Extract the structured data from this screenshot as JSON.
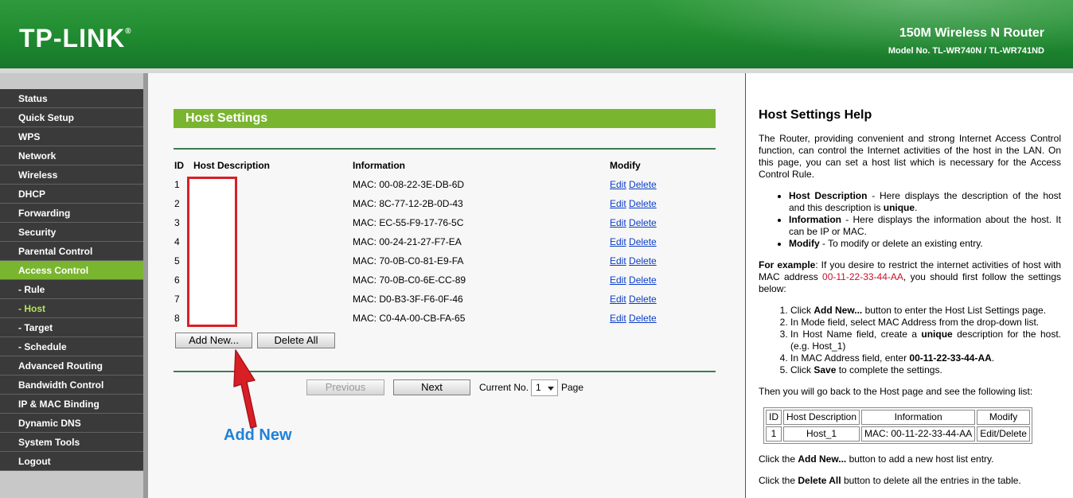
{
  "header": {
    "logo": "TP-LINK",
    "logo_mark": "®",
    "router_name": "150M Wireless N Router",
    "model_no": "Model No. TL-WR740N / TL-WR741ND"
  },
  "sidebar": {
    "items": [
      {
        "label": "Status"
      },
      {
        "label": "Quick Setup"
      },
      {
        "label": "WPS"
      },
      {
        "label": "Network"
      },
      {
        "label": "Wireless"
      },
      {
        "label": "DHCP"
      },
      {
        "label": "Forwarding"
      },
      {
        "label": "Security"
      },
      {
        "label": "Parental Control"
      },
      {
        "label": "Access Control",
        "state": "active"
      },
      {
        "label": "- Rule"
      },
      {
        "label": "- Host",
        "state": "current"
      },
      {
        "label": "- Target"
      },
      {
        "label": "- Schedule"
      },
      {
        "label": "Advanced Routing"
      },
      {
        "label": "Bandwidth Control"
      },
      {
        "label": "IP & MAC Binding"
      },
      {
        "label": "Dynamic DNS"
      },
      {
        "label": "System Tools"
      },
      {
        "label": "Logout"
      }
    ]
  },
  "main": {
    "title": "Host Settings",
    "columns": {
      "id": "ID",
      "desc": "Host Description",
      "info": "Information",
      "modify": "Modify"
    },
    "rows": [
      {
        "id": "1",
        "desc": "",
        "info": "MAC: 00-08-22-3E-DB-6D"
      },
      {
        "id": "2",
        "desc": "",
        "info": "MAC: 8C-77-12-2B-0D-43"
      },
      {
        "id": "3",
        "desc": "",
        "info": "MAC: EC-55-F9-17-76-5C"
      },
      {
        "id": "4",
        "desc": "",
        "info": "MAC: 00-24-21-27-F7-EA"
      },
      {
        "id": "5",
        "desc": "",
        "info": "MAC: 70-0B-C0-81-E9-FA"
      },
      {
        "id": "6",
        "desc": "",
        "info": "MAC: 70-0B-C0-6E-CC-89"
      },
      {
        "id": "7",
        "desc": "",
        "info": "MAC: D0-B3-3F-F6-0F-46"
      },
      {
        "id": "8",
        "desc": "",
        "info": "MAC: C0-4A-00-CB-FA-65"
      }
    ],
    "edit_label": "Edit",
    "delete_label": "Delete",
    "add_new_label": "Add New...",
    "delete_all_label": "Delete All",
    "previous_label": "Previous",
    "next_label": "Next",
    "current_no_label": "Current No.",
    "page_value": "1",
    "page_label": "Page",
    "annotation_label": "Add New"
  },
  "help": {
    "title": "Host Settings Help",
    "intro": "The Router, providing convenient and strong Internet Access Control function, can control the Internet activities of the host in the LAN. On this page, you can set a host list which is necessary for the Access Control Rule.",
    "bullets": [
      {
        "term": "Host Description",
        "text_a": " - Here displays the description of the host and this description is ",
        "strong": "unique",
        "text_b": "."
      },
      {
        "term": "Information",
        "text_a": " - Here displays the information about the host. It can be IP or MAC.",
        "strong": "",
        "text_b": ""
      },
      {
        "term": "Modify",
        "text_a": " - To modify or delete an existing entry.",
        "strong": "",
        "text_b": ""
      }
    ],
    "example_lead": "For example",
    "example_a": ": If you desire to restrict the internet activities of host with MAC address ",
    "example_mac": "00-11-22-33-44-AA",
    "example_b": ", you should first follow the settings below:",
    "steps": [
      {
        "a": "Click ",
        "strong": "Add New...",
        "b": " button to enter the Host List Settings page."
      },
      {
        "a": "In Mode field, select MAC Address from the drop-down list.",
        "strong": "",
        "b": ""
      },
      {
        "a": "In Host Name field, create a ",
        "strong": "unique",
        "b": " description for the host. (e.g. Host_1)"
      },
      {
        "a": "In MAC Address field, enter ",
        "strong": "00-11-22-33-44-AA",
        "b": "."
      },
      {
        "a": "Click ",
        "strong": "Save",
        "b": " to complete the settings."
      }
    ],
    "then_text": "Then you will go back to the Host page and see the following list:",
    "example_table": {
      "headers": [
        "ID",
        "Host Description",
        "Information",
        "Modify"
      ],
      "row": [
        "1",
        "Host_1",
        "MAC: 00-11-22-33-44-AA",
        "Edit/Delete"
      ]
    },
    "click_add_a": "Click the ",
    "click_add_strong": "Add New...",
    "click_add_b": " button to add a new host list entry.",
    "click_delete_a": "Click the ",
    "click_delete_strong": "Delete All",
    "click_delete_b": " button to delete all the entries in the table."
  },
  "colors": {
    "brand_green": "#1f8a2f",
    "menu_active": "#7ab530",
    "annotation_red": "#d81f26",
    "annotation_blue": "#1f82d8"
  }
}
